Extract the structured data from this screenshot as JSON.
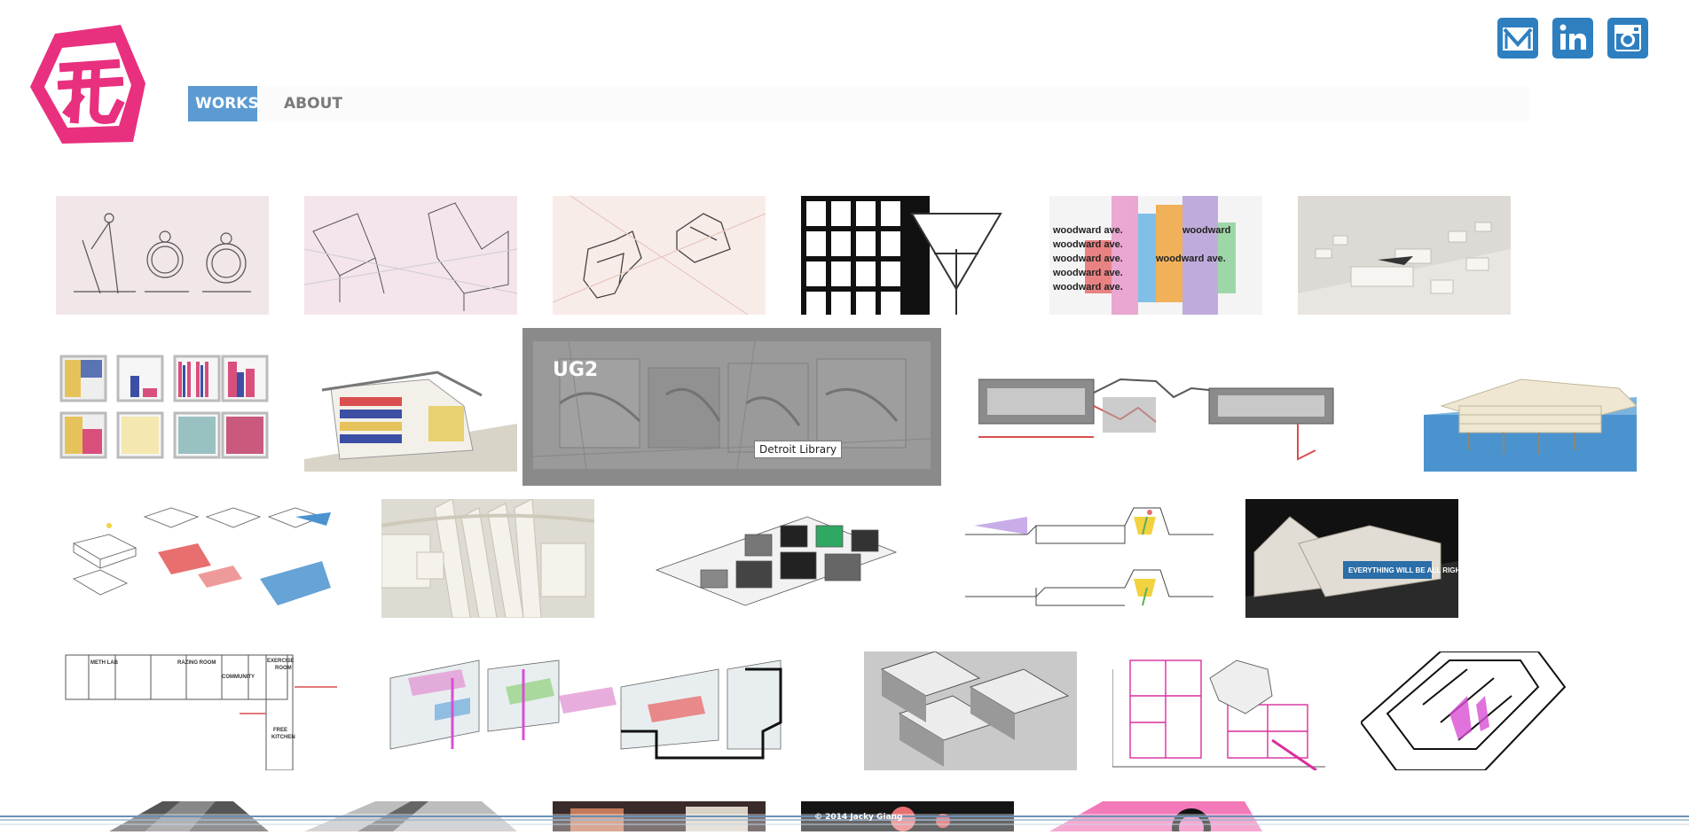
{
  "site": {
    "brand_color": "#e8307f",
    "accent_color": "#5b9bd1"
  },
  "nav": {
    "works_label": "WORKS",
    "about_label": "ABOUT"
  },
  "social": [
    {
      "name": "mail-icon"
    },
    {
      "name": "linkedin-icon"
    },
    {
      "name": "instagram-icon"
    }
  ],
  "hover": {
    "title": "UG2",
    "tooltip": "Detroit Library"
  },
  "footer": {
    "copyright": "© 2014 Jacky Giang"
  }
}
